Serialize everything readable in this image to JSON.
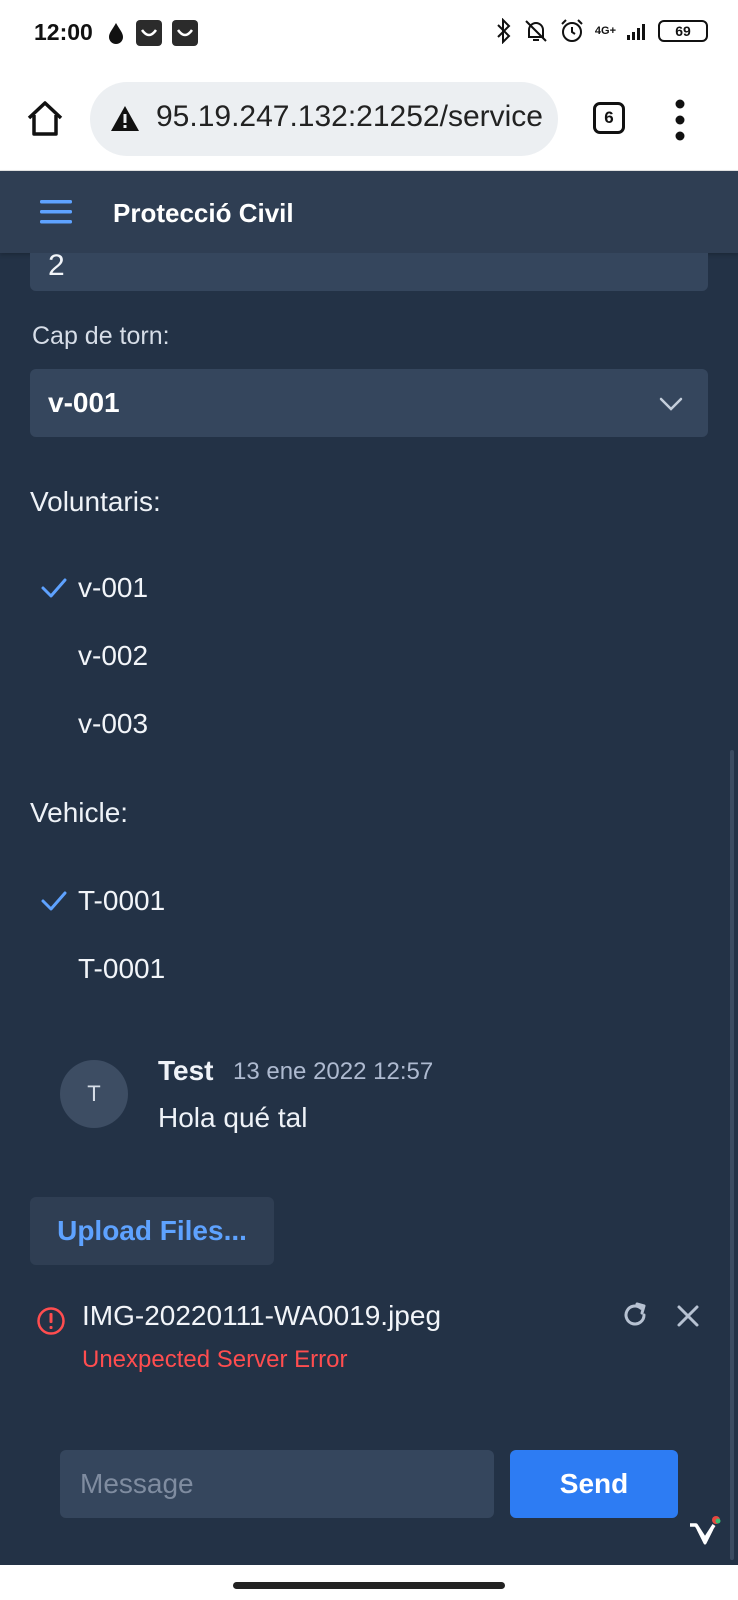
{
  "status_bar": {
    "time": "12:00",
    "network": "4G+",
    "battery": "69"
  },
  "browser": {
    "url": "95.19.247.132:21252/service",
    "tab_count": "6"
  },
  "app": {
    "title": "Protecció Civil"
  },
  "form": {
    "partial_field_value": "2",
    "cap_de_torn": {
      "label": "Cap de torn:",
      "selected": "v-001"
    },
    "voluntaris": {
      "label": "Voluntaris:",
      "items": [
        {
          "label": "v-001",
          "checked": true
        },
        {
          "label": "v-002",
          "checked": false
        },
        {
          "label": "v-003",
          "checked": false
        }
      ]
    },
    "vehicle": {
      "label": "Vehicle:",
      "items": [
        {
          "label": "T-0001",
          "checked": true
        },
        {
          "label": "T-0001",
          "checked": false
        }
      ]
    }
  },
  "comment": {
    "avatar_initial": "T",
    "author": "Test",
    "date": "13 ene 2022 12:57",
    "text": "Hola qué tal"
  },
  "upload": {
    "button_label": "Upload Files...",
    "file_name": "IMG-20220111-WA0019.jpeg",
    "error": "Unexpected Server Error"
  },
  "message": {
    "placeholder": "Message",
    "send_label": "Send"
  },
  "colors": {
    "background": "#233246",
    "header": "#2f3e53",
    "field": "#35465d",
    "accent": "#2d7cf3",
    "link": "#5ea2ff",
    "error": "#ff4d4f"
  }
}
